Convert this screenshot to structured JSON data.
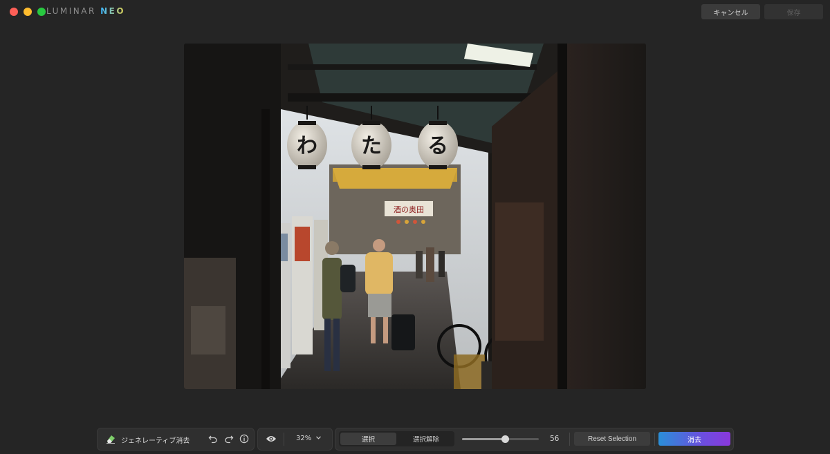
{
  "app": {
    "logo_part1": "LUMINAR ",
    "logo_part2": "NEO"
  },
  "header": {
    "cancel_label": "キャンセル",
    "save_label": "保存"
  },
  "photo": {
    "lantern_1": "わ",
    "lantern_2": "た",
    "lantern_3": "る",
    "alley_sign": "酒の奥田"
  },
  "toolbar": {
    "tool_name": "ジェネレーティブ消去",
    "tool_icon": "eraser-icon",
    "zoom_label": "32%",
    "select_label": "選択",
    "deselect_label": "選択解除",
    "brush_size": "56",
    "brush_size_fraction": 0.56,
    "reset_label": "Reset Selection",
    "erase_label": "消去"
  },
  "colors": {
    "accent_start": "#2a8fd8",
    "accent_end": "#8a38dc",
    "background": "#252525"
  }
}
